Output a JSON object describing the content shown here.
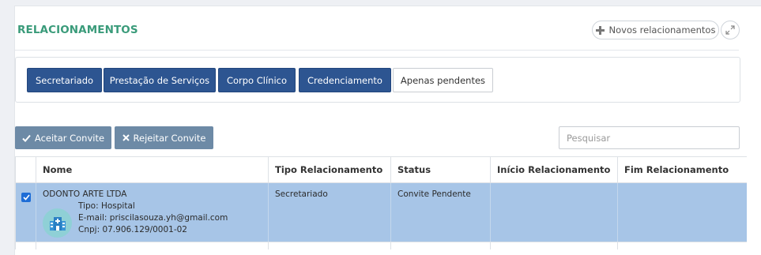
{
  "header": {
    "title": "RELACIONAMENTOS",
    "new_button_label": "Novos relacionamentos"
  },
  "filters": [
    {
      "label": "Secretariado",
      "active": true
    },
    {
      "label": "Prestação de Serviços",
      "active": true
    },
    {
      "label": "Corpo Clínico",
      "active": true
    },
    {
      "label": "Credenciamento",
      "active": true
    },
    {
      "label": "Apenas pendentes",
      "active": false
    }
  ],
  "actions": {
    "accept_label": "Aceitar Convite",
    "reject_label": "Rejeitar Convite"
  },
  "search": {
    "placeholder": "Pesquisar",
    "value": ""
  },
  "table": {
    "columns": [
      "Nome",
      "Tipo Relacionamento",
      "Status",
      "Início Relacionamento",
      "Fim Relacionamento"
    ],
    "rows": [
      {
        "checked": true,
        "name": "ODONTO ARTE LTDA",
        "tipo": "Tipo: Hospital",
        "email": "E-mail: priscilasouza.yh@gmail.com",
        "cnpj": "Cnpj: 07.906.129/0001-02",
        "tipo_relacionamento": "Secretariado",
        "status": "Convite Pendente",
        "inicio": "",
        "fim": ""
      }
    ]
  },
  "colors": {
    "title": "#3a9b7a",
    "primary": "#2d5591",
    "action": "#6d8aa6",
    "selected_row": "#a7c5e7",
    "checkbox": "#1e6dd6",
    "avatar": "#8fd0d6"
  },
  "icons": {
    "new_button": "plus-icon",
    "expand": "expand-icon",
    "accept": "check-icon",
    "reject": "x-icon",
    "avatar": "hospital-icon"
  }
}
